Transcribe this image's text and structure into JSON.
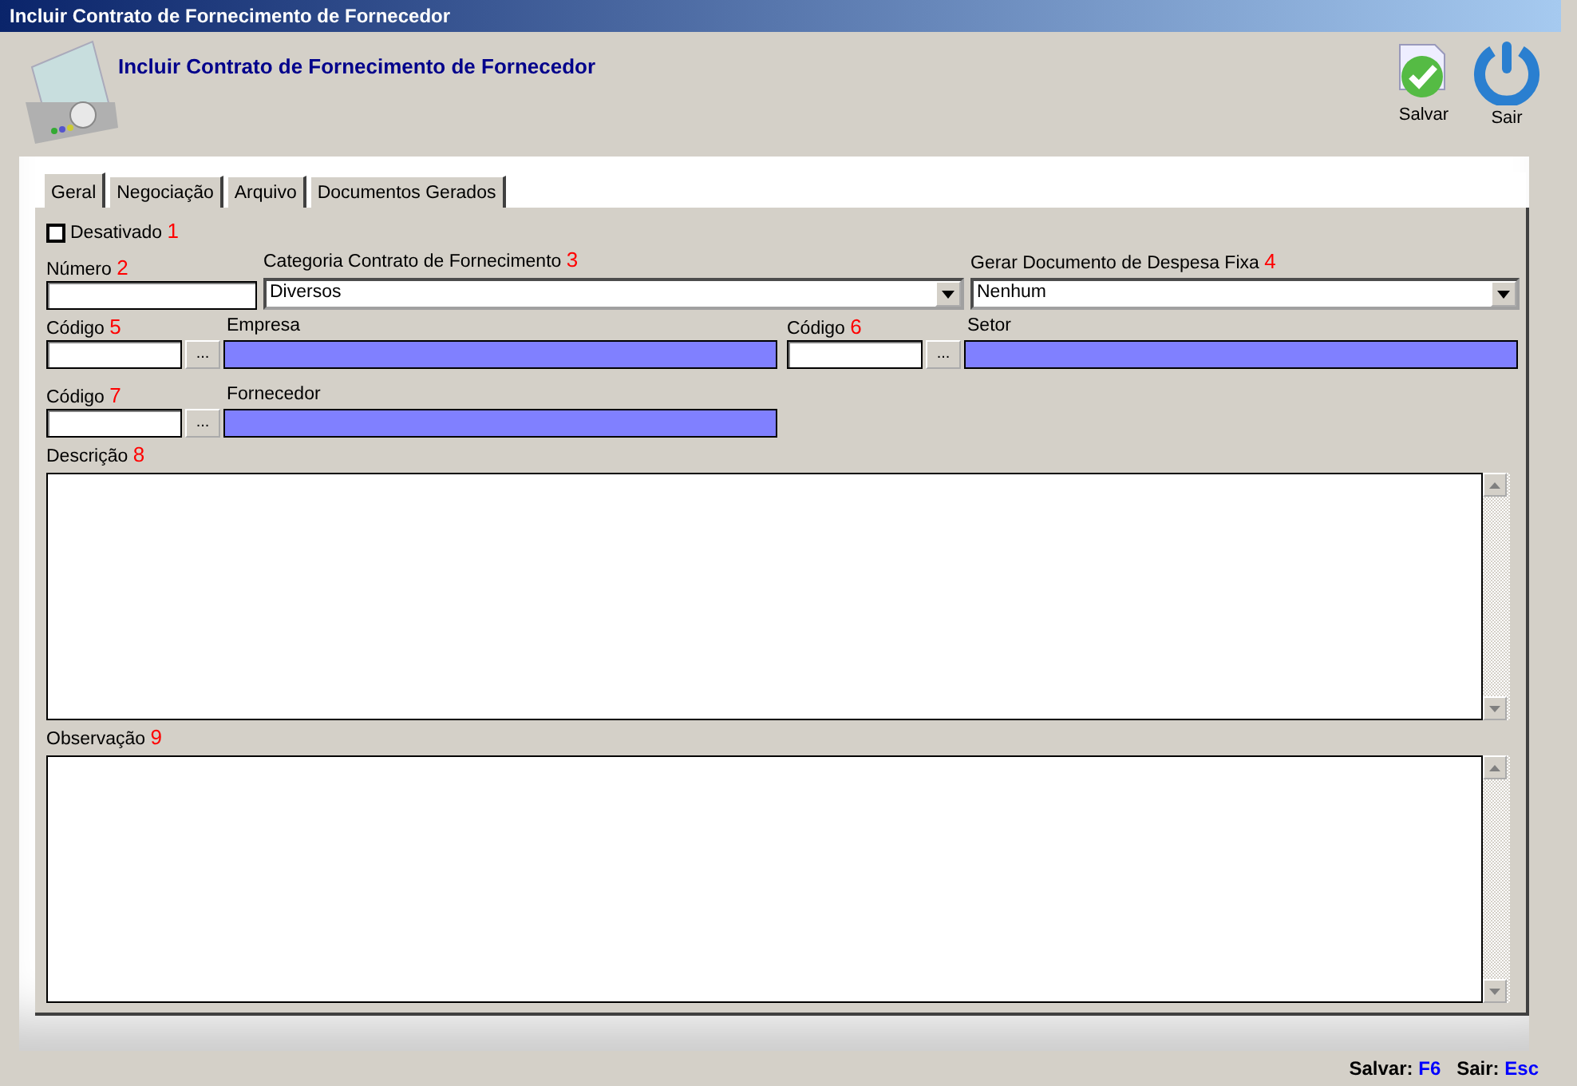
{
  "window": {
    "title": "Incluir Contrato de Fornecimento de Fornecedor"
  },
  "header": {
    "title": "Incluir Contrato de Fornecimento de Fornecedor"
  },
  "toolbar": [
    {
      "kind": "save",
      "label": "Salvar"
    },
    {
      "kind": "exit",
      "label": "Sair"
    }
  ],
  "tabs": [
    {
      "label": "Geral",
      "selected": true
    },
    {
      "label": "Negociação",
      "selected": false
    },
    {
      "label": "Arquivo",
      "selected": false
    },
    {
      "label": "Documentos Gerados",
      "selected": false
    }
  ],
  "checkbox": {
    "label": "Desativado",
    "number": "1",
    "checked": false
  },
  "rows": [
    [
      {
        "kind": "text",
        "label": "Número",
        "number": "2"
      },
      {
        "kind": "select",
        "label": "Categoria Contrato de Fornecimento",
        "number": "3",
        "value": "Diversos"
      },
      {
        "kind": "select",
        "label": "Gerar Documento de Despesa Fixa",
        "number": "4",
        "value": "Nenhum"
      }
    ],
    [
      {
        "kind": "lookup",
        "label": "Código",
        "number": "5",
        "button": "...",
        "description_label": "Empresa"
      },
      {
        "kind": "lookup",
        "label": "Código",
        "number": "6",
        "button": "...",
        "description_label": "Setor"
      }
    ],
    [
      {
        "kind": "lookup",
        "label": "Código",
        "number": "7",
        "button": "...",
        "description_label": "Fornecedor"
      }
    ],
    [
      {
        "kind": "textarea",
        "label": "Descrição",
        "number": "8"
      }
    ],
    [
      {
        "kind": "textarea",
        "label": "Observação",
        "number": "9"
      }
    ]
  ],
  "shortcuts": [
    {
      "label": "Salvar:",
      "key": "F6"
    },
    {
      "label": "Sair:",
      "key": "Esc"
    }
  ]
}
